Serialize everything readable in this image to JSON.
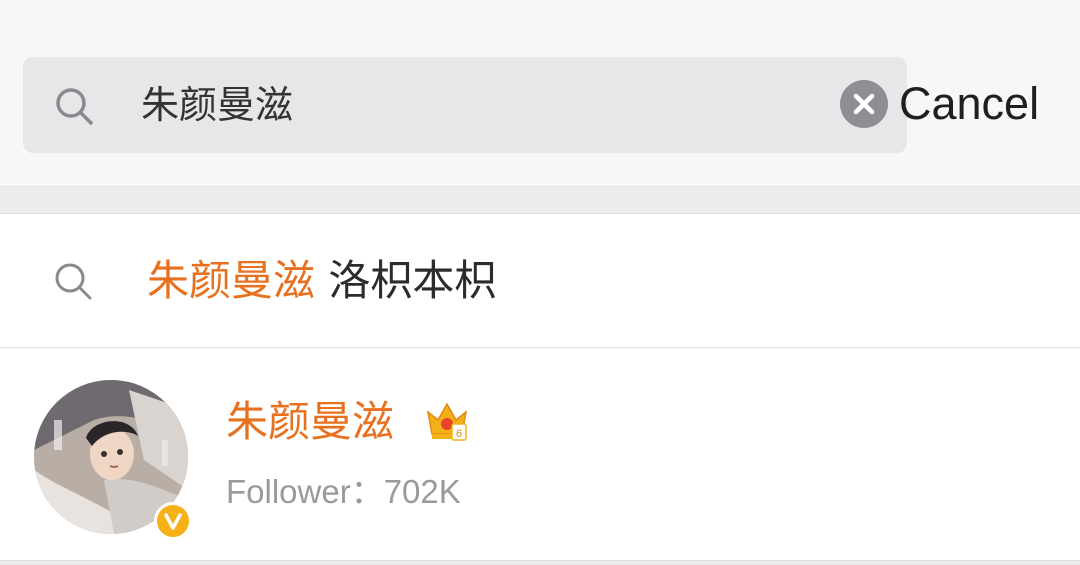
{
  "search": {
    "query": "朱颜曼滋",
    "cancel_label": "Cancel",
    "icons": {
      "search": "search-icon",
      "clear": "clear-icon"
    }
  },
  "suggestion": {
    "highlight": "朱颜曼滋",
    "rest": " 洛枳本枳",
    "icon": "search-icon"
  },
  "user_result": {
    "name": "朱颜曼滋",
    "badge_level": "6",
    "follower_label": "Follower：",
    "follower_count": "702K",
    "verified_icon": "verified-v-icon",
    "crown_icon": "crown-member-icon"
  },
  "colors": {
    "highlight": "#e8711f",
    "verified": "#f7b017",
    "text_primary": "#2b2b2b",
    "text_secondary": "#9a9a9a"
  }
}
